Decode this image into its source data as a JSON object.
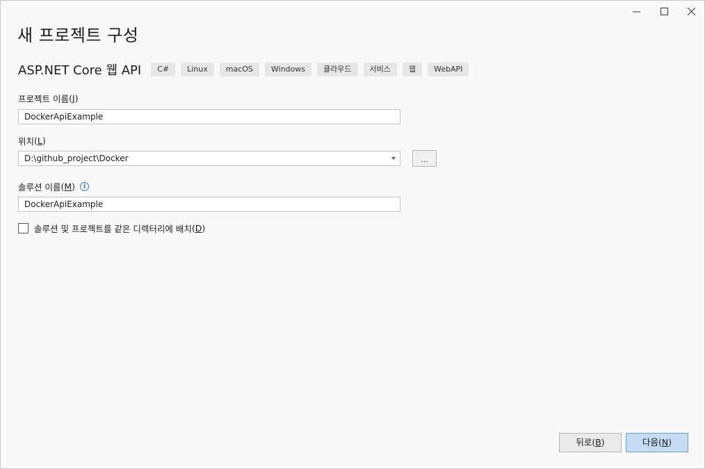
{
  "window": {
    "controls": [
      "minimize-icon",
      "maximize-icon",
      "close-icon"
    ]
  },
  "page_title": "새 프로젝트 구성",
  "template": {
    "name": "ASP.NET Core 웹 API",
    "tags": [
      "C#",
      "Linux",
      "macOS",
      "Windows",
      "클라우드",
      "서비스",
      "웹",
      "WebAPI"
    ]
  },
  "project_name": {
    "label": "프로젝트 이름",
    "mnemonic": "J",
    "value": "DockerApiExample"
  },
  "location": {
    "label": "위치",
    "mnemonic": "L",
    "value": "D:\\github_project\\Docker",
    "browse_label": "..."
  },
  "solution_name": {
    "label": "솔루션 이름",
    "mnemonic": "M",
    "value": "DockerApiExample",
    "info_icon": "info-icon"
  },
  "same_dir_checkbox": {
    "label": "솔루션 및 프로젝트를 같은 디렉터리에 배치",
    "mnemonic": "D",
    "checked": false
  },
  "footer": {
    "back_label": "뒤로",
    "back_mnemonic": "B",
    "next_label": "다음",
    "next_mnemonic": "N"
  },
  "colors": {
    "accent": "#2b7bc0",
    "primary_button_bg": "#c6dcf3",
    "primary_button_border": "#6b9bd1"
  }
}
